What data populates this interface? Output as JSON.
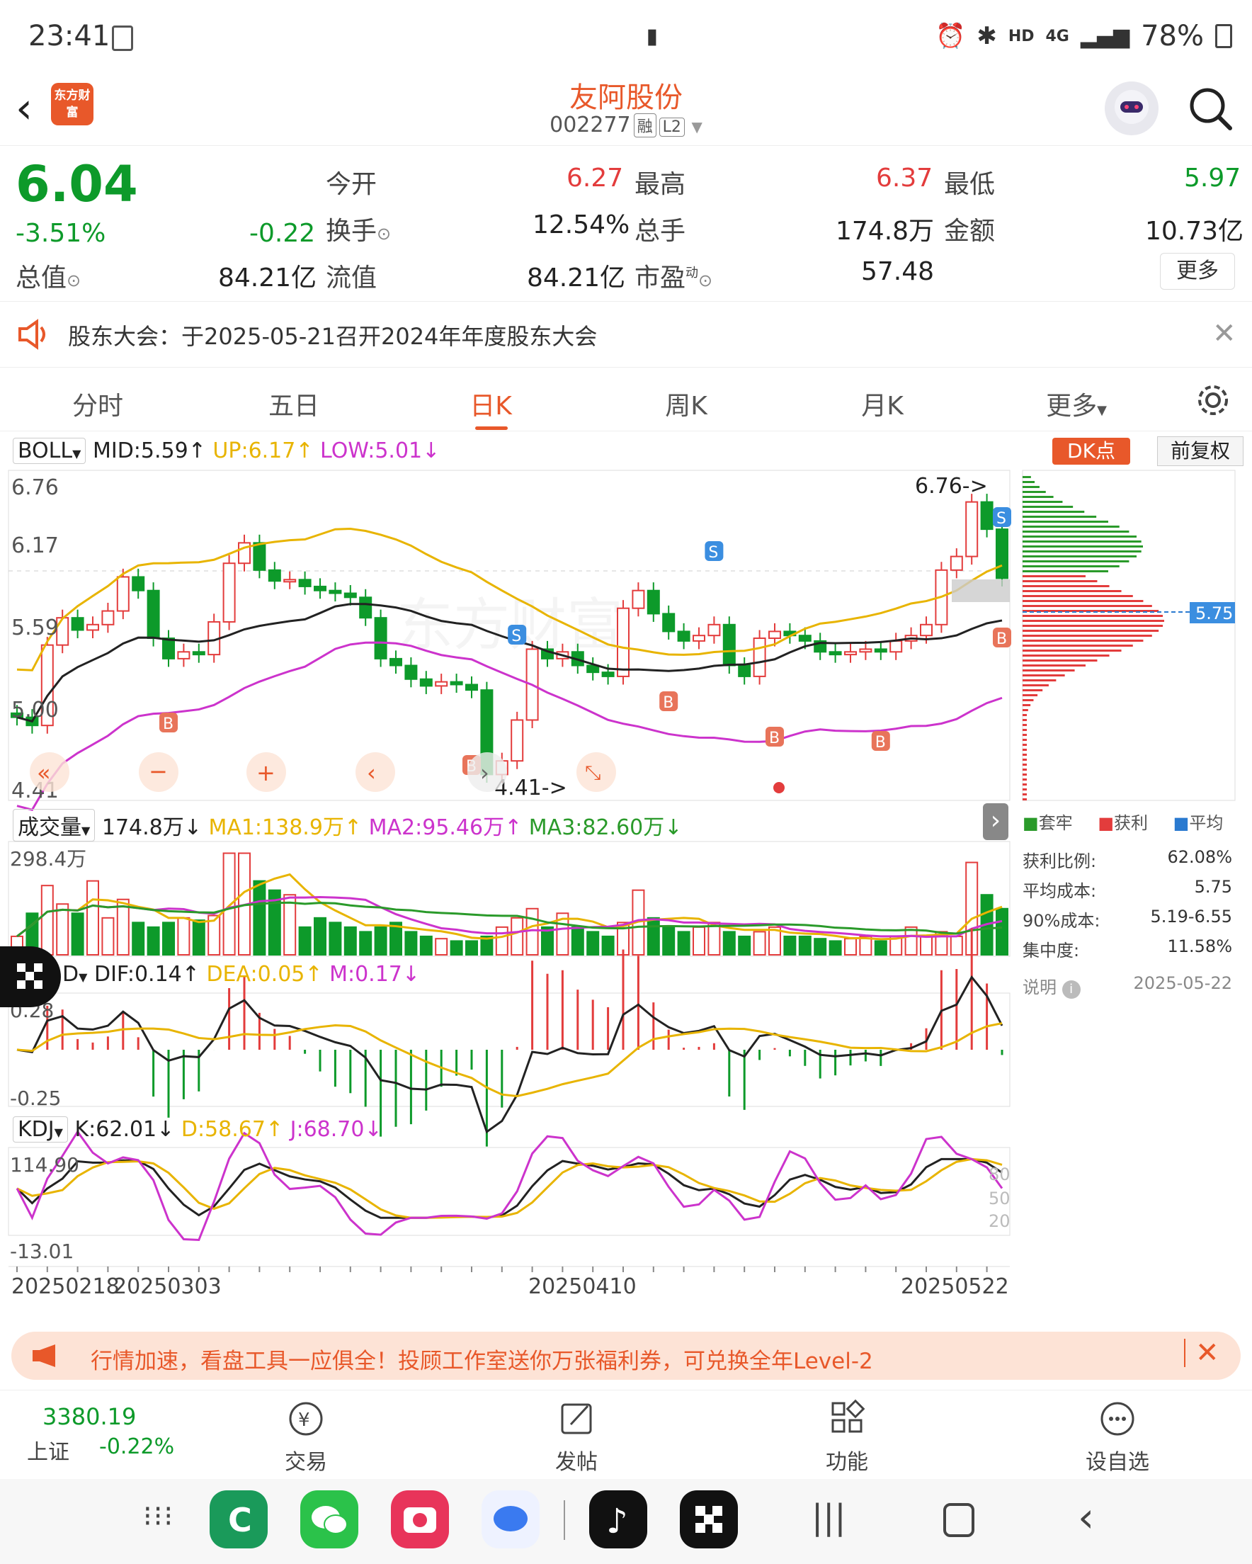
{
  "status_bar": {
    "time": "23:41",
    "battery": "78%",
    "hd": "HD",
    "net": "4G"
  },
  "header": {
    "stock_name": "友阿股份",
    "stock_code": "002277",
    "tag_rong": "融",
    "tag_l2": "L2",
    "logo_text": "东方财富"
  },
  "quote": {
    "price": "6.04",
    "change_pct": "-3.51%",
    "change": "-0.22",
    "open_label": "今开",
    "open": "6.27",
    "high_label": "最高",
    "high": "6.37",
    "low_label": "最低",
    "low": "5.97",
    "turnover_label": "换手",
    "turnover": "12.54%",
    "volume_label": "总手",
    "volume": "174.8万",
    "amount_label": "金额",
    "amount": "10.73亿",
    "mktcap_label": "总值",
    "mktcap": "84.21亿",
    "float_label": "流值",
    "float_cap": "84.21亿",
    "pe_label": "市盈",
    "pe_sup": "动",
    "pe": "57.48",
    "more": "更多"
  },
  "notice": {
    "text": "股东大会：于2025-05-21召开2024年年度股东大会"
  },
  "tabs": [
    "分时",
    "五日",
    "日K",
    "周K",
    "月K",
    "更多"
  ],
  "boll": {
    "name": "BOLL",
    "mid": "MID:5.59",
    "up": "UP:6.17",
    "low": "LOW:5.01"
  },
  "kline": {
    "dk_button": "DK点",
    "adj_button": "前复权",
    "y_labels": [
      "6.76",
      "6.17",
      "5.59",
      "5.00",
      "4.41"
    ],
    "max_note": "6.76->",
    "min_note": "4.41->",
    "cost_tag": "5.75",
    "watermark": "东方财富"
  },
  "volume": {
    "name": "成交量",
    "value": "174.8万",
    "ma1": "MA1:138.9万",
    "ma2": "MA2:95.46万",
    "ma3": "MA3:82.60万",
    "y_label": "298.4万"
  },
  "macd": {
    "name": "D",
    "dif": "DIF:0.14",
    "dea": "DEA:0.05",
    "m": "M:0.17",
    "y_top": "0.28",
    "y_bottom": "-0.25"
  },
  "kdj": {
    "name": "KDJ",
    "k": "K:62.01",
    "d": "D:58.67",
    "j": "J:68.70",
    "y_top": "114.90",
    "y_bottom": "-13.01",
    "levels": [
      "80",
      "50",
      "20"
    ]
  },
  "dates": [
    "20250218",
    "20250303",
    "20250410",
    "20250522"
  ],
  "chip": {
    "legend": [
      "套牢",
      "获利",
      "平均"
    ],
    "stats": [
      {
        "label": "获利比例:",
        "value": "62.08%"
      },
      {
        "label": "平均成本:",
        "value": "5.75"
      },
      {
        "label": "90%成本:",
        "value": "5.19-6.55"
      },
      {
        "label": "集中度:",
        "value": "11.58%"
      }
    ],
    "note": "说明",
    "date": "2025-05-22"
  },
  "ad": {
    "text": "行情加速，看盘工具一应俱全！投顾工作室送你万张福利券，可兑换全年Level-2"
  },
  "bottom_nav": {
    "index_value": "3380.19",
    "index_name": "上证",
    "index_change": "-0.22%",
    "items": [
      "交易",
      "发帖",
      "功能",
      "设自选"
    ]
  },
  "colors": {
    "up": "#e33c3c",
    "down": "#0d9a2a",
    "accent": "#e8582a",
    "boll_up": "#e8b400",
    "boll_low": "#cc33cc"
  }
}
